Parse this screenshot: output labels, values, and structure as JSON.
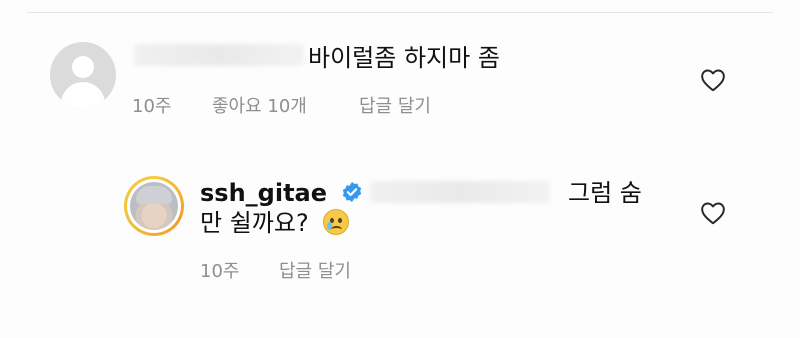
{
  "comment": {
    "text": "바이럴좀 하지마 좀",
    "time": "10주",
    "likes": "좋아요 10개",
    "reply_label": "답글 달기"
  },
  "reply": {
    "username": "ssh_gitae",
    "text_line1": "그럼 숨",
    "text_line2": "만 쉴까요?",
    "time": "10주",
    "reply_label": "답글 달기"
  },
  "icons": {
    "like": "heart-outline-icon",
    "verified": "verified-badge-icon",
    "emoji": "crying-face-emoji"
  },
  "colors": {
    "verified_blue": "#3897f0",
    "meta_gray": "#8e8e8e"
  }
}
